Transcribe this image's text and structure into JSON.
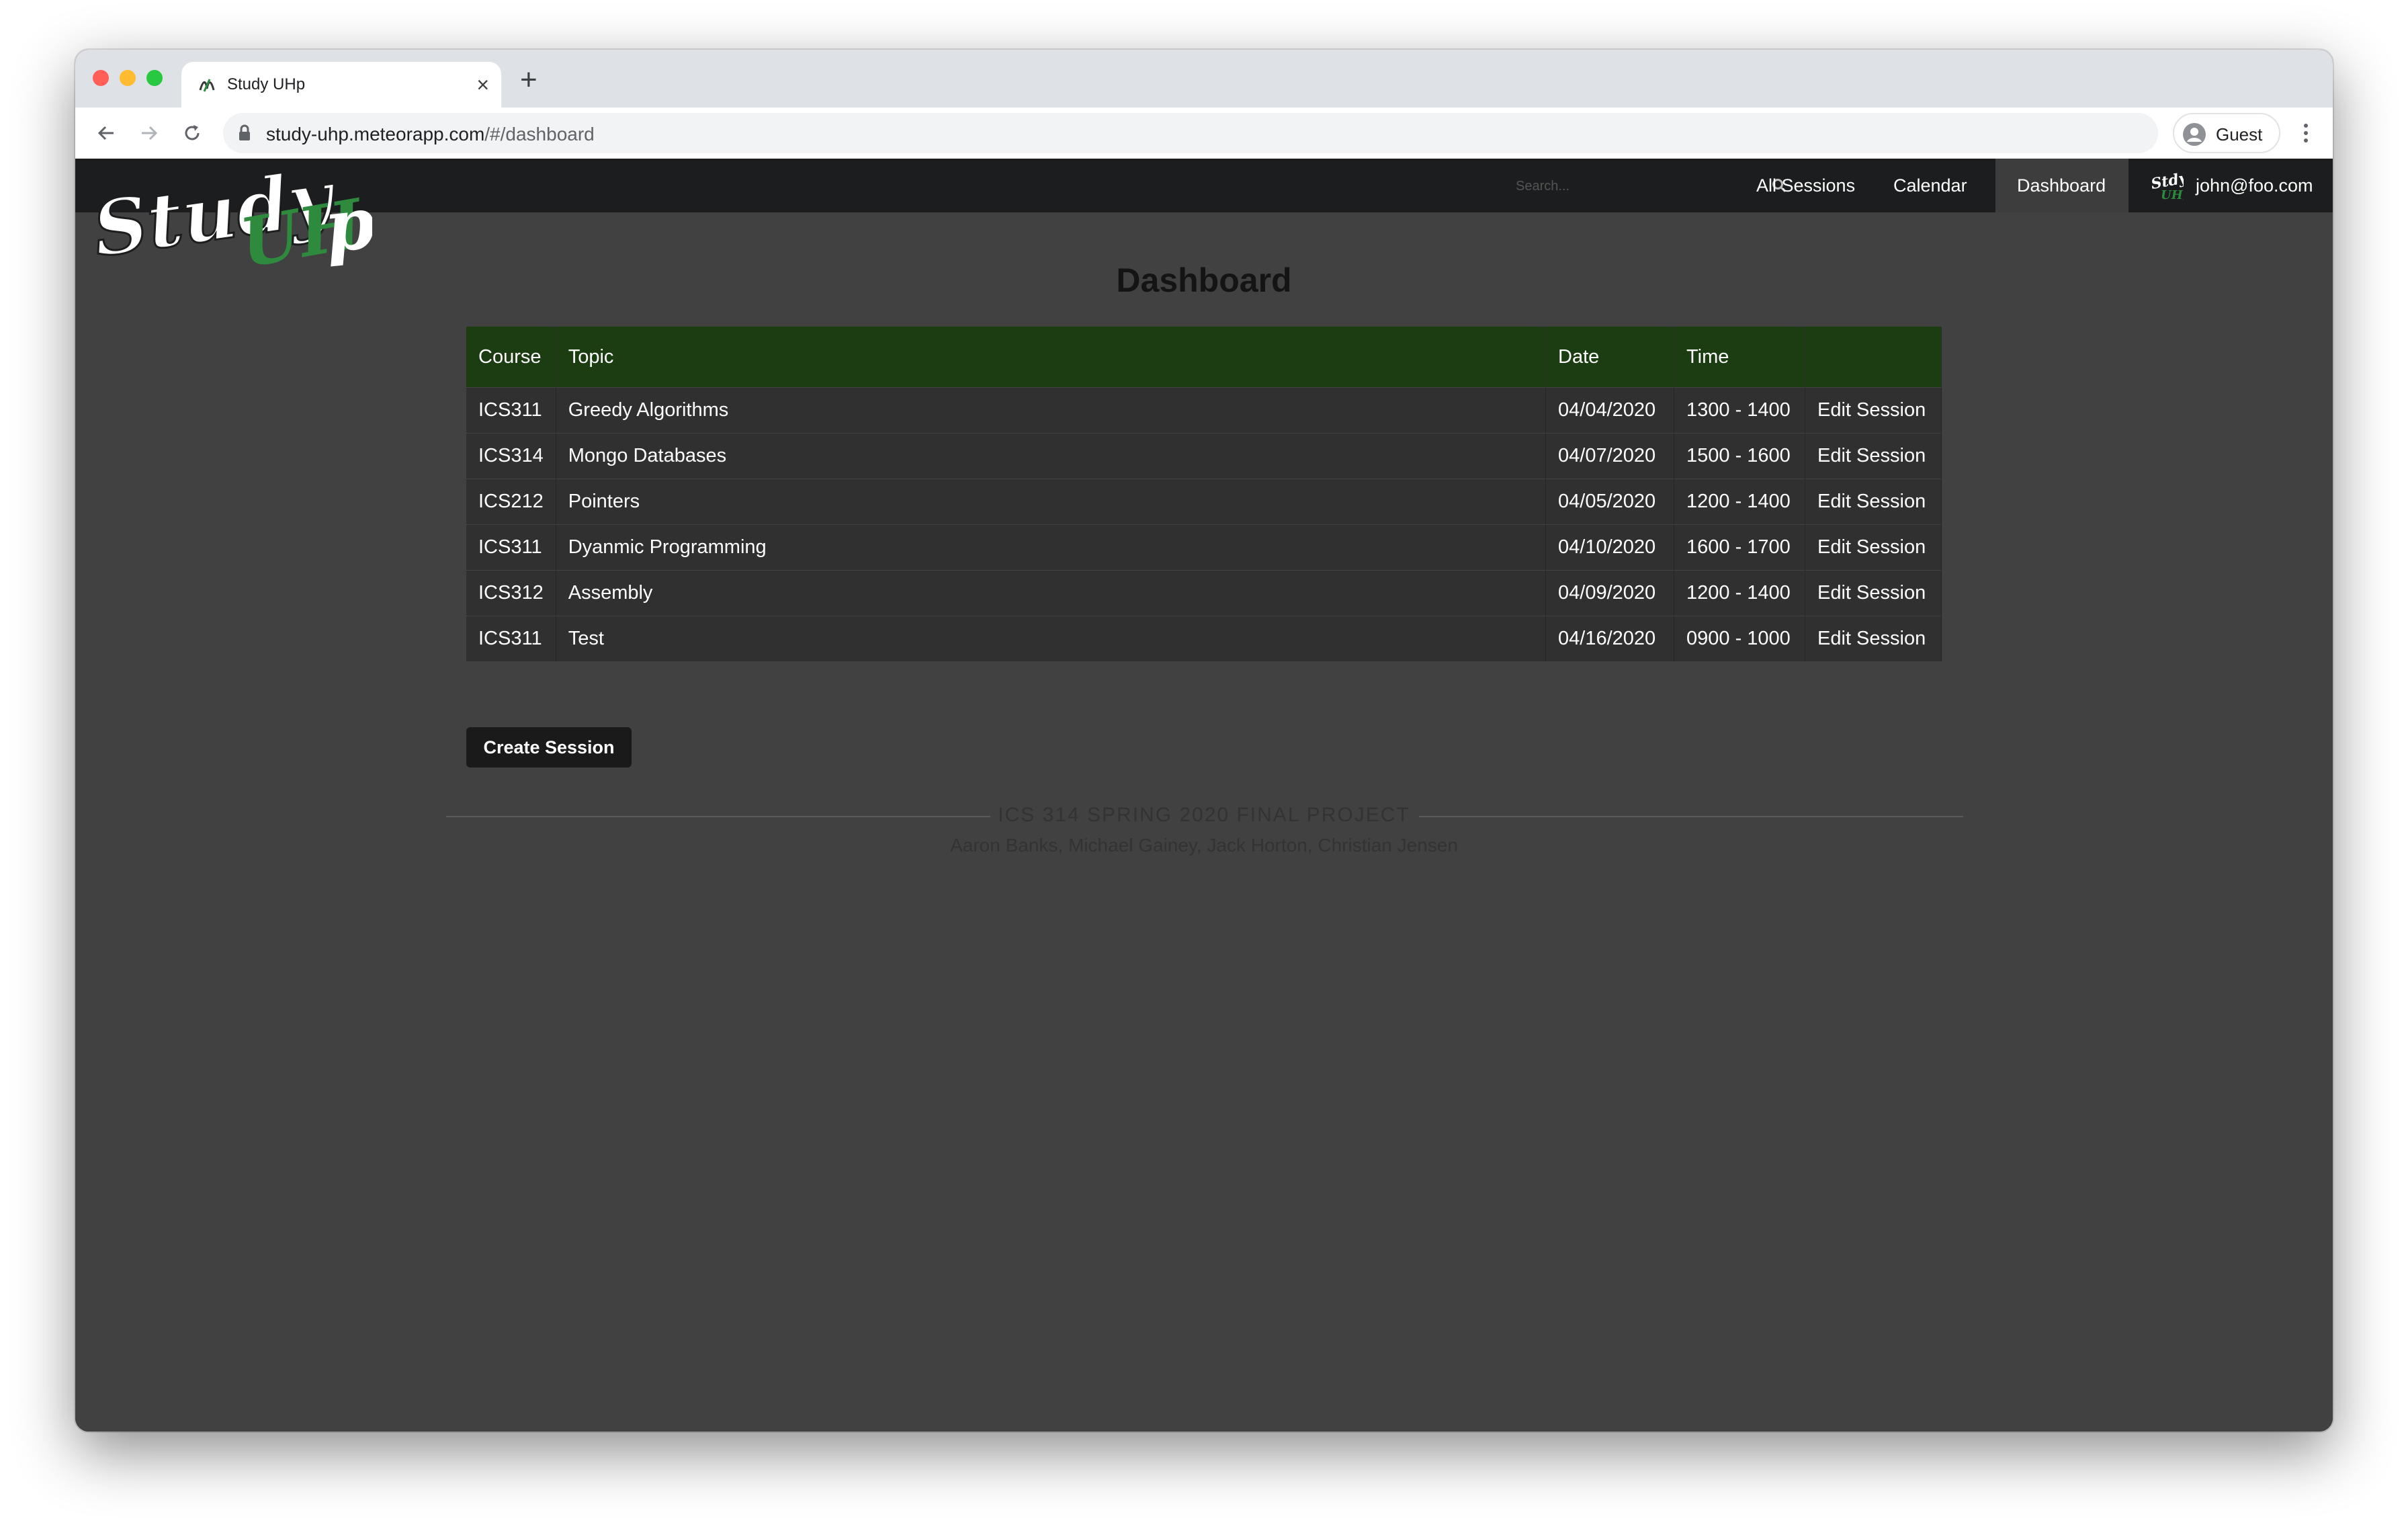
{
  "browser": {
    "tab_title": "Study UHp",
    "new_tab_label": "+",
    "url_host": "study-uhp.meteorapp.com",
    "url_path": "/#/dashboard",
    "profile_label": "Guest",
    "icons": [
      "back-arrow-icon",
      "forward-arrow-icon",
      "reload-icon",
      "lock-icon",
      "profile-icon",
      "kebab-menu-icon",
      "close-icon"
    ]
  },
  "navbar": {
    "logo_text_primary": "Study",
    "logo_text_accent": "UHp",
    "search_placeholder": "Search...",
    "items": [
      {
        "label": "All Sessions"
      },
      {
        "label": "Calendar"
      },
      {
        "label": "Dashboard",
        "active": true
      }
    ],
    "user_email": "john@foo.com"
  },
  "dashboard": {
    "title": "Dashboard",
    "columns": [
      "Course",
      "Topic",
      "Date",
      "Time",
      ""
    ],
    "rows": [
      {
        "course": "ICS311",
        "topic": "Greedy Algorithms",
        "date": "04/04/2020",
        "time": "1300 - 1400",
        "action": "Edit Session"
      },
      {
        "course": "ICS314",
        "topic": "Mongo Databases",
        "date": "04/07/2020",
        "time": "1500 - 1600",
        "action": "Edit Session"
      },
      {
        "course": "ICS212",
        "topic": "Pointers",
        "date": "04/05/2020",
        "time": "1200 - 1400",
        "action": "Edit Session"
      },
      {
        "course": "ICS311",
        "topic": "Dyanmic Programming",
        "date": "04/10/2020",
        "time": "1600 - 1700",
        "action": "Edit Session"
      },
      {
        "course": "ICS312",
        "topic": "Assembly",
        "date": "04/09/2020",
        "time": "1200 - 1400",
        "action": "Edit Session"
      },
      {
        "course": "ICS311",
        "topic": "Test",
        "date": "04/16/2020",
        "time": "0900 - 1000",
        "action": "Edit Session"
      }
    ],
    "create_button_label": "Create Session"
  },
  "footer": {
    "heading": "ICS 314 SPRING 2020 FINAL PROJECT",
    "authors": "Aaron Banks, Michael Gainey, Jack Horton, Christian Jensen"
  },
  "colors": {
    "navbar_bg": "#1c1d1e",
    "page_bg": "#414141",
    "table_header_bg": "#1c3d11",
    "table_row_bg": "#303030",
    "accent_green": "#2e8b3e"
  }
}
